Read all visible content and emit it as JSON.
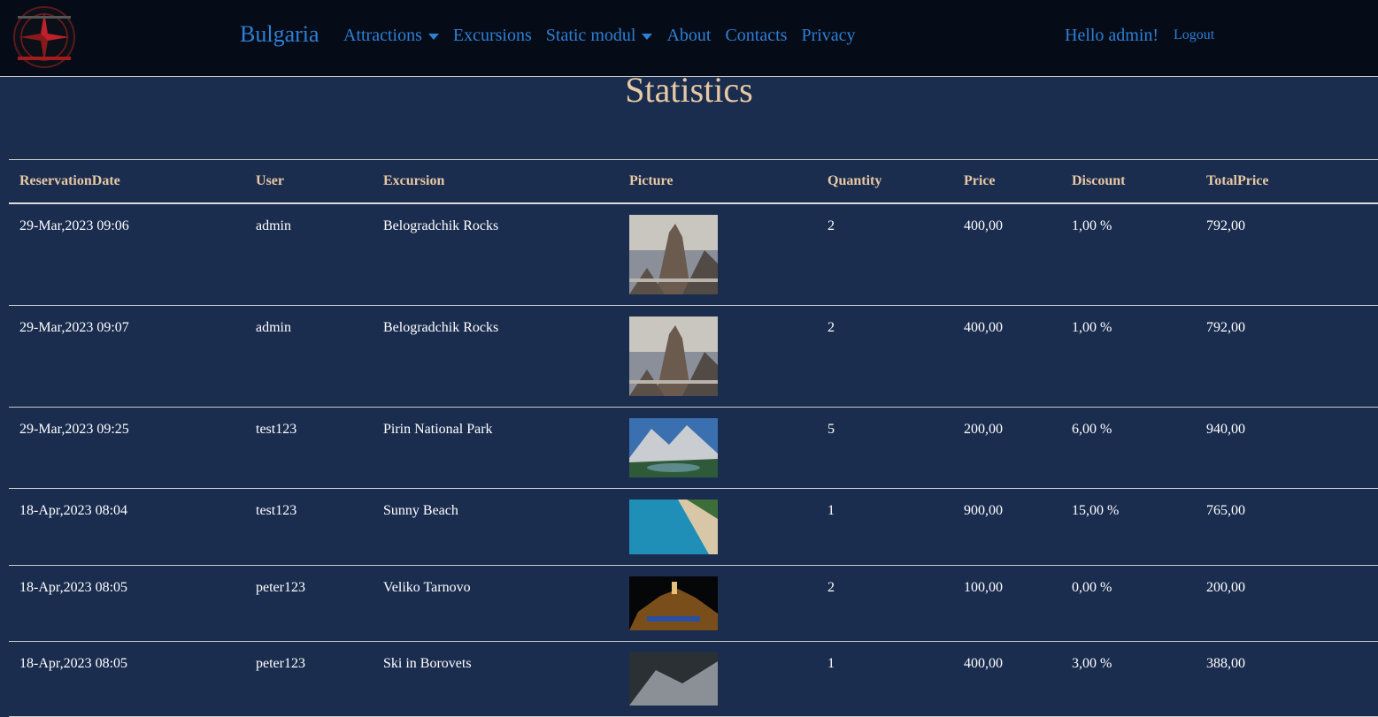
{
  "nav": {
    "brand": "Bulgaria",
    "links": [
      {
        "label": "Attractions",
        "dropdown": true
      },
      {
        "label": "Excursions",
        "dropdown": false
      },
      {
        "label": "Static modul",
        "dropdown": true
      },
      {
        "label": "About",
        "dropdown": false
      },
      {
        "label": "Contacts",
        "dropdown": false
      },
      {
        "label": "Privacy",
        "dropdown": false
      }
    ],
    "greeting": "Hello admin!",
    "logout": "Logout"
  },
  "page": {
    "title": "Statistics"
  },
  "table": {
    "headers": [
      "ReservationDate",
      "User",
      "Excursion",
      "Picture",
      "Quantity",
      "Price",
      "Discount",
      "TotalPrice"
    ],
    "rows": [
      {
        "date": "29-Mar,2023 09:06",
        "user": "admin",
        "excursion": "Belogradchik Rocks",
        "picture": "rocks",
        "quantity": "2",
        "price": "400,00",
        "discount": "1,00 %",
        "total": "792,00"
      },
      {
        "date": "29-Mar,2023 09:07",
        "user": "admin",
        "excursion": "Belogradchik Rocks",
        "picture": "rocks",
        "quantity": "2",
        "price": "400,00",
        "discount": "1,00 %",
        "total": "792,00"
      },
      {
        "date": "29-Mar,2023 09:25",
        "user": "test123",
        "excursion": "Pirin National Park",
        "picture": "mountains",
        "quantity": "5",
        "price": "200,00",
        "discount": "6,00 %",
        "total": "940,00"
      },
      {
        "date": "18-Apr,2023 08:04",
        "user": "test123",
        "excursion": "Sunny Beach",
        "picture": "beach",
        "quantity": "1",
        "price": "900,00",
        "discount": "15,00 %",
        "total": "765,00"
      },
      {
        "date": "18-Apr,2023 08:05",
        "user": "peter123",
        "excursion": "Veliko Tarnovo",
        "picture": "night-city",
        "quantity": "2",
        "price": "100,00",
        "discount": "0,00 %",
        "total": "200,00"
      },
      {
        "date": "18-Apr,2023 08:05",
        "user": "peter123",
        "excursion": "Ski in Borovets",
        "picture": "ski",
        "quantity": "1",
        "price": "400,00",
        "discount": "3,00 %",
        "total": "388,00"
      }
    ]
  },
  "colors": {
    "background": "#1b2d4f",
    "navbar": "#050c17",
    "link": "#2f7fd6",
    "heading": "#e7c9a3"
  }
}
